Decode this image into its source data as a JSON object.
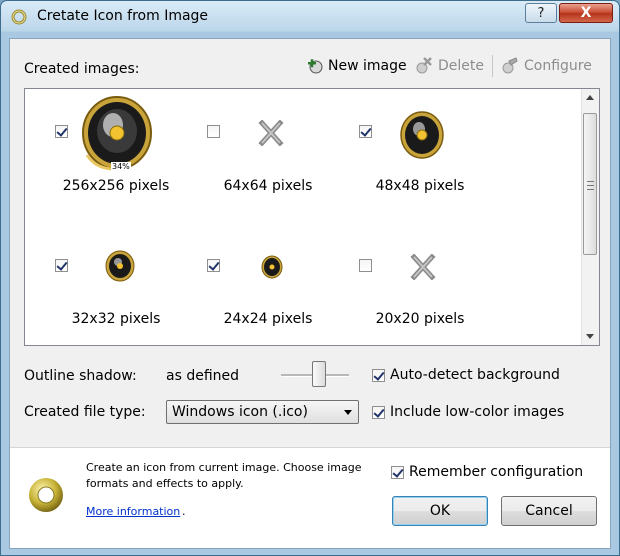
{
  "window": {
    "title": "Cretate Icon from Image"
  },
  "titlebar": {
    "help_label": "?",
    "close_label": "X"
  },
  "toolbar": {
    "section_label": "Created images:",
    "new_image_label": "New image",
    "delete_label": "Delete",
    "configure_label": "Configure"
  },
  "images": [
    {
      "label": "256x256 pixels",
      "checked": true,
      "icon": "speaker-icon",
      "badge": "34%"
    },
    {
      "label": "64x64 pixels",
      "checked": false,
      "icon": "x-placeholder-icon"
    },
    {
      "label": "48x48 pixels",
      "checked": true,
      "icon": "speaker-icon"
    },
    {
      "label": "32x32 pixels",
      "checked": true,
      "icon": "speaker-icon"
    },
    {
      "label": "24x24 pixels",
      "checked": true,
      "icon": "speaker-icon"
    },
    {
      "label": "20x20 pixels",
      "checked": false,
      "icon": "x-placeholder-icon"
    }
  ],
  "options": {
    "outline_shadow_label": "Outline shadow:",
    "outline_shadow_value": "as defined",
    "file_type_label": "Created file type:",
    "file_type_value": "Windows icon (.ico)",
    "auto_detect_label": "Auto-detect background",
    "auto_detect_checked": true,
    "low_color_label": "Include low-color images",
    "low_color_checked": true
  },
  "footer": {
    "description": "Create an icon from current image. Choose image formats and effects to apply.",
    "more_info_link": "More information",
    "more_info_suffix": ".",
    "remember_label": "Remember configuration",
    "remember_checked": true,
    "ok_label": "OK",
    "cancel_label": "Cancel"
  },
  "colors": {
    "speaker_gold": "#d9a21b",
    "speaker_dark": "#141414",
    "link": "#0033cc",
    "titlebar": "#bcd6ea"
  }
}
